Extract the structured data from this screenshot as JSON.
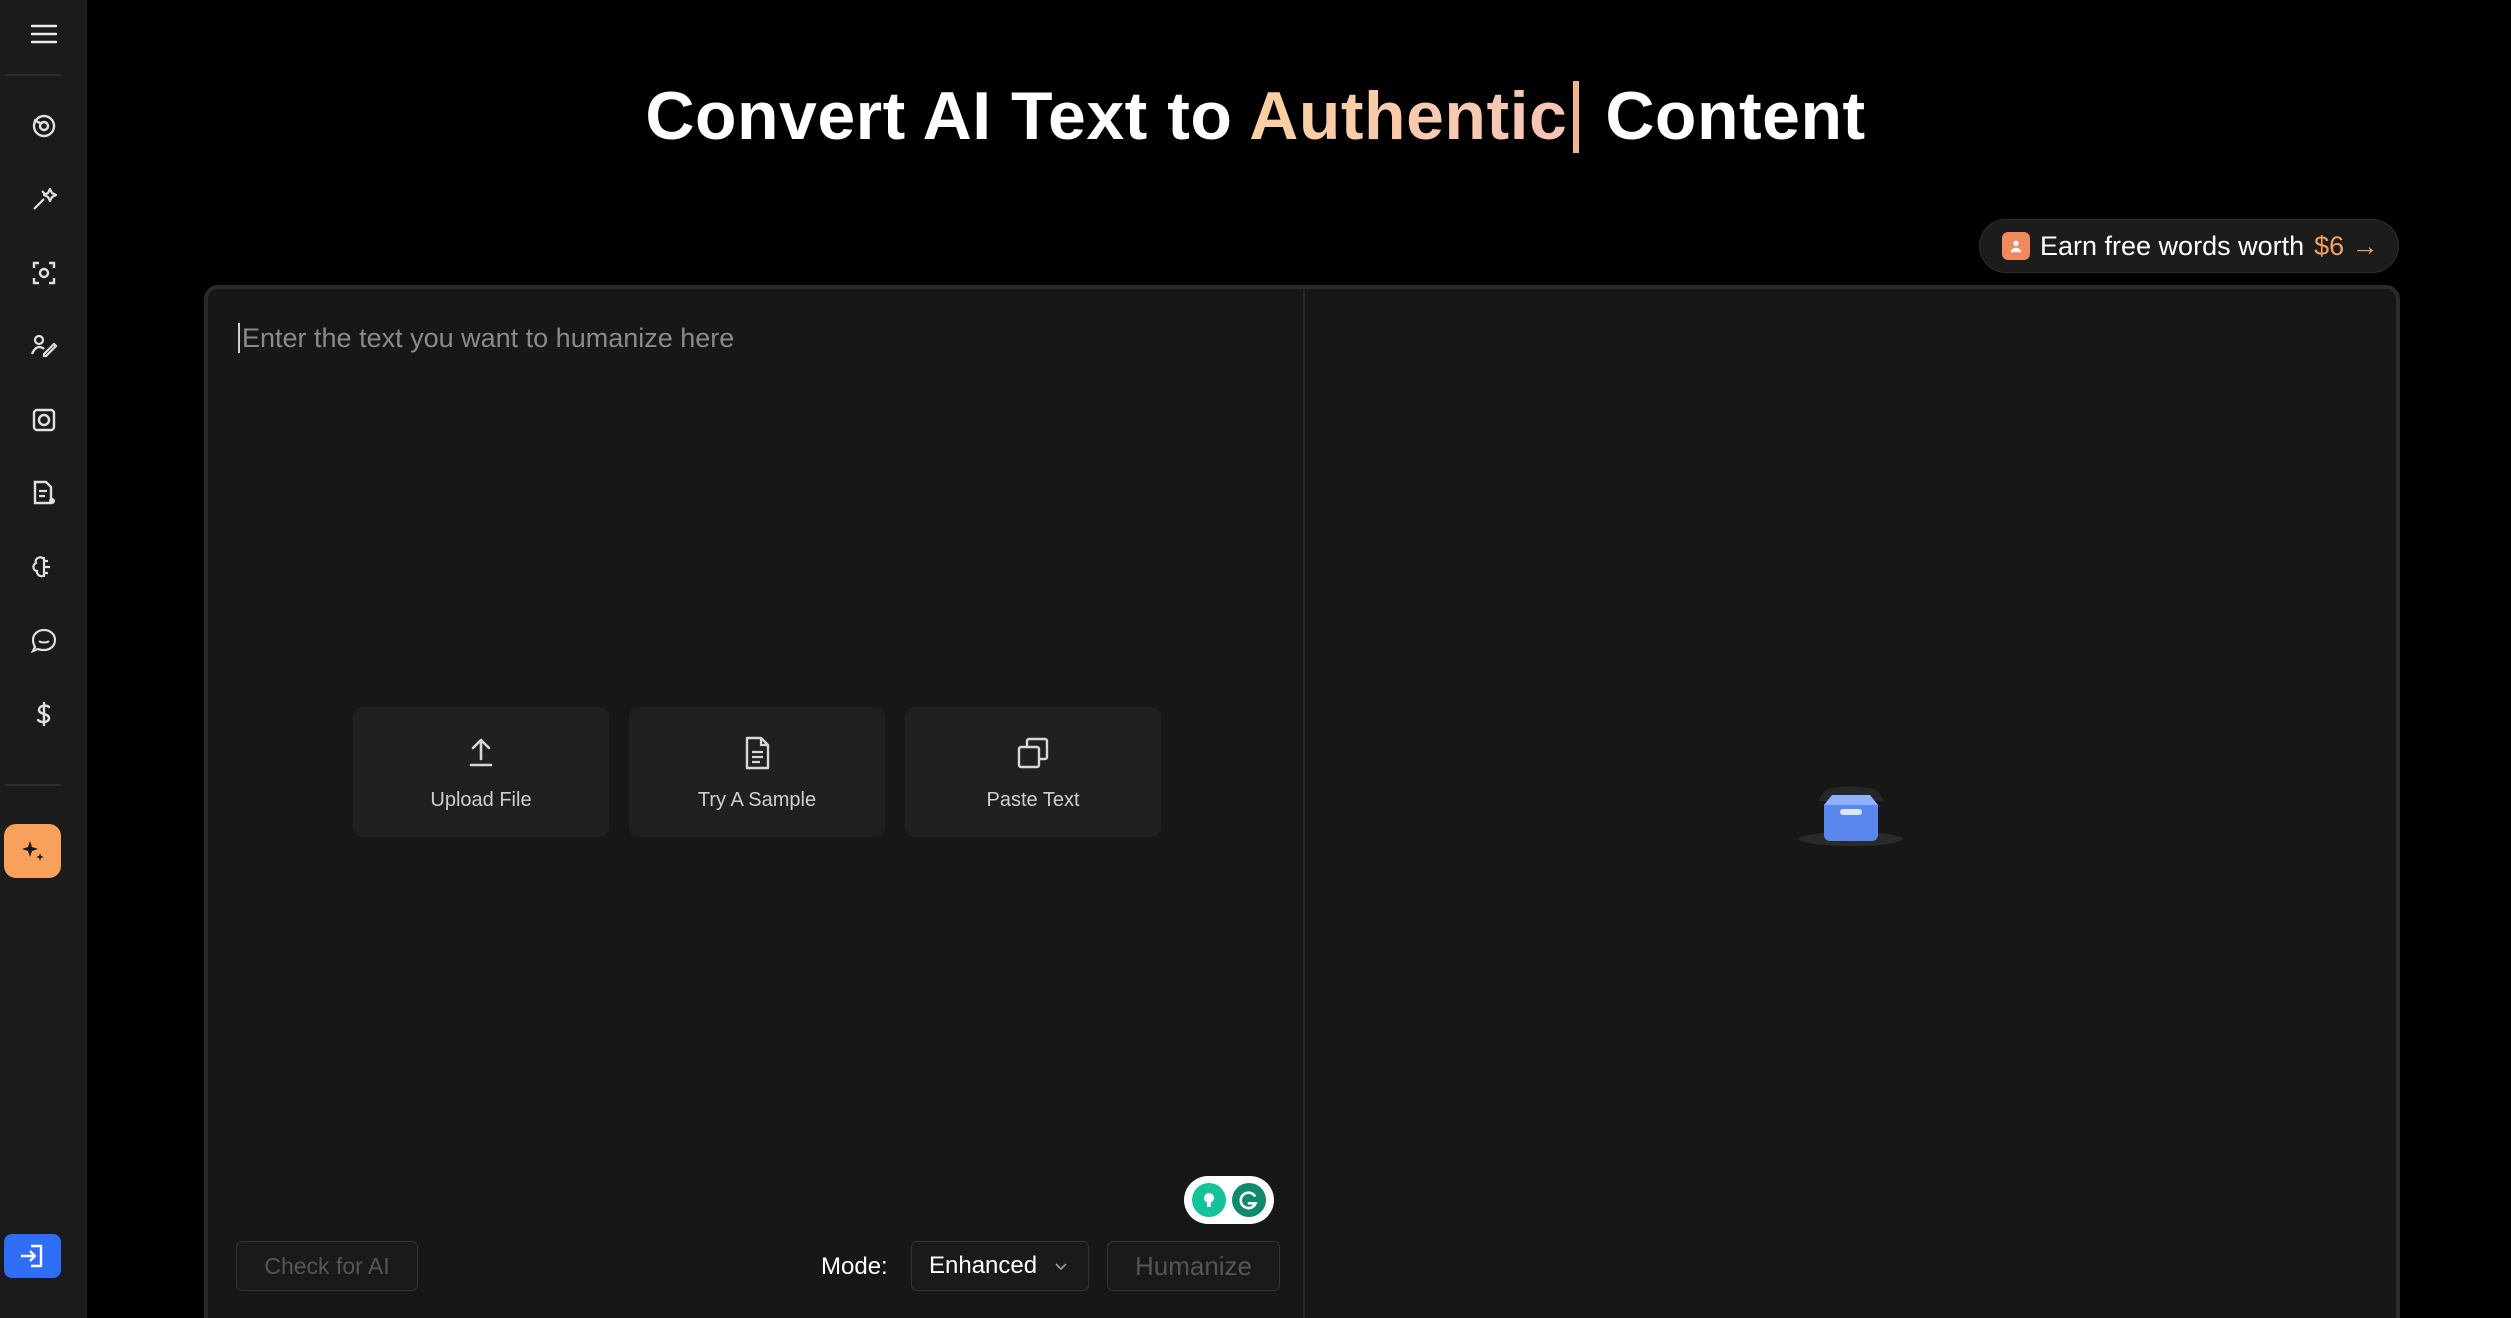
{
  "title": {
    "prefix": "Convert AI Text to",
    "highlight": "Authentic",
    "suffix": "Content"
  },
  "earn": {
    "label": "Earn free words worth",
    "amount": "$6",
    "arrow": "→"
  },
  "editor": {
    "placeholder": "Enter the text you want to humanize here",
    "actions": [
      {
        "label": "Upload File",
        "icon": "upload-icon"
      },
      {
        "label": "Try A Sample",
        "icon": "document-icon"
      },
      {
        "label": "Paste Text",
        "icon": "copy-icon"
      }
    ],
    "check_label": "Check for AI",
    "mode_label": "Mode:",
    "mode_value": "Enhanced",
    "humanize_label": "Humanize"
  },
  "sidebar": {
    "icons": [
      "menu-icon",
      "ai-detector-icon",
      "humanizer-icon",
      "scan-icon",
      "writer-icon",
      "focus-icon",
      "docs-icon",
      "brain-icon",
      "chat-icon",
      "pricing-icon",
      "sparkle-icon",
      "login-icon"
    ]
  },
  "colors": {
    "accent_orange": "#f7a15c",
    "login_blue": "#2f6df6",
    "caret": "#f2b58d"
  }
}
